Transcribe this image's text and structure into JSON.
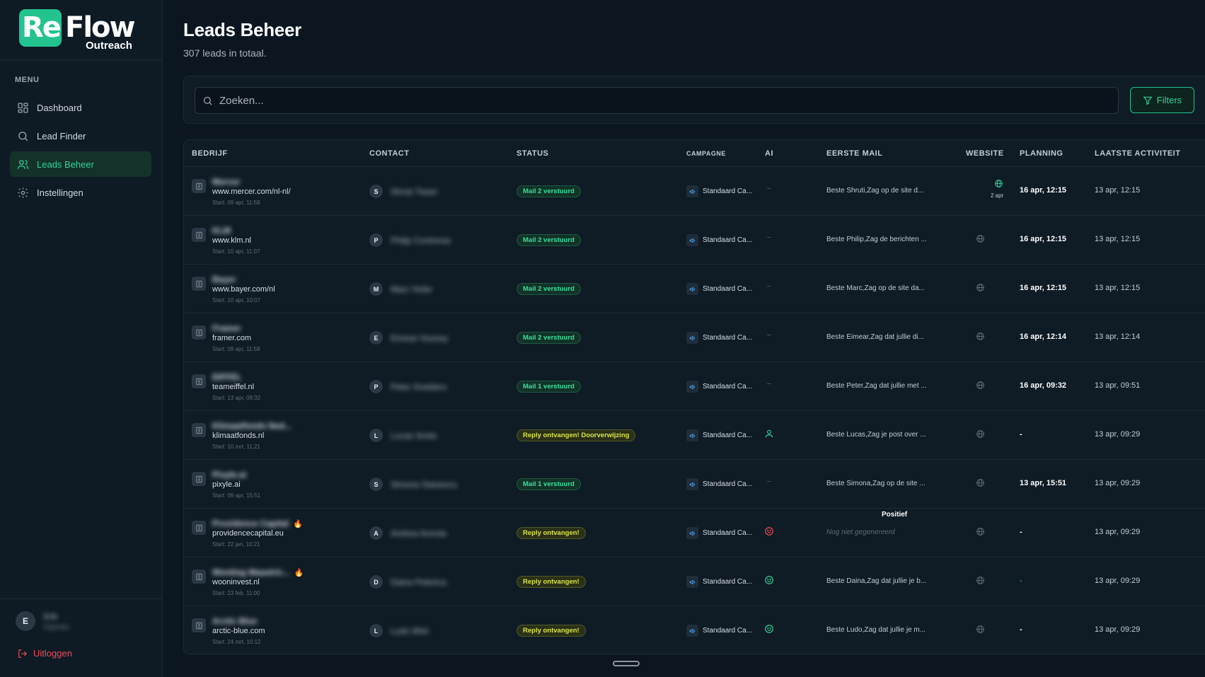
{
  "brand": {
    "logo_re": "Re",
    "logo_flow": "Flow",
    "logo_sub": "Outreach",
    "accent": "#22c38e"
  },
  "sidebar": {
    "menu_title": "MENU",
    "items": [
      {
        "label": "Dashboard",
        "icon": "dashboard-icon",
        "active": false
      },
      {
        "label": "Lead Finder",
        "icon": "search-icon",
        "active": false
      },
      {
        "label": "Leads Beheer",
        "icon": "users-icon",
        "active": true
      },
      {
        "label": "Instellingen",
        "icon": "gear-icon",
        "active": false
      }
    ],
    "user_initial": "E",
    "user_name": "Erik",
    "user_role": "Eigenaar",
    "logout_label": "Uitloggen"
  },
  "header": {
    "title": "Leads Beheer",
    "subtitle": "307 leads in totaal."
  },
  "search": {
    "placeholder": "Zoeken...",
    "value": ""
  },
  "filters_label": "Filters",
  "table": {
    "headers": {
      "bedrijf": "BEDRIJF",
      "contact": "CONTACT",
      "status": "STATUS",
      "campagne": "CAMPAGNE",
      "ai": "AI",
      "eerste_mail": "EERSTE MAIL",
      "website": "WEBSITE",
      "planning": "PLANNING",
      "laatste": "LAATSTE ACTIVITEIT"
    },
    "rows": [
      {
        "company": "Mercer",
        "site": "www.mercer.com/nl-nl/",
        "start": "Start: 09 apr, 11:58",
        "hot": false,
        "initial": "S",
        "contact": "Shruti Tiwari",
        "status": "Mail 2 verstuurd",
        "status_type": "green",
        "campaign": "Standaard Ca...",
        "ai": "–",
        "ai_type": "none",
        "mail": "Beste Shruti,Zag op de site d...",
        "mail_muted": false,
        "website_ok": true,
        "website_date": "2 apr",
        "planning": "16 apr, 12:15",
        "planning_muted": false,
        "last": "13 apr, 12:15"
      },
      {
        "company": "KLM",
        "site": "www.klm.nl",
        "start": "Start: 10 apr, 11:07",
        "hot": false,
        "initial": "P",
        "contact": "Philip Contreras",
        "status": "Mail 2 verstuurd",
        "status_type": "green",
        "campaign": "Standaard Ca...",
        "ai": "–",
        "ai_type": "none",
        "mail": "Beste Philip,Zag de berichten ...",
        "mail_muted": false,
        "website_ok": false,
        "website_date": "",
        "planning": "16 apr, 12:15",
        "planning_muted": false,
        "last": "13 apr, 12:15"
      },
      {
        "company": "Bayer",
        "site": "www.bayer.com/nl",
        "start": "Start: 10 apr, 10:07",
        "hot": false,
        "initial": "M",
        "contact": "Marc Hofer",
        "status": "Mail 2 verstuurd",
        "status_type": "green",
        "campaign": "Standaard Ca...",
        "ai": "–",
        "ai_type": "none",
        "mail": "Beste Marc,Zag op de site da...",
        "mail_muted": false,
        "website_ok": false,
        "website_date": "",
        "planning": "16 apr, 12:15",
        "planning_muted": false,
        "last": "13 apr, 12:15"
      },
      {
        "company": "Framer",
        "site": "framer.com",
        "start": "Start: 09 apr, 11:58",
        "hot": false,
        "initial": "E",
        "contact": "Eimear Hussey",
        "status": "Mail 2 verstuurd",
        "status_type": "green",
        "campaign": "Standaard Ca...",
        "ai": "–",
        "ai_type": "none",
        "mail": "Beste Eimear,Zag dat jullie di...",
        "mail_muted": false,
        "website_ok": false,
        "website_date": "",
        "planning": "16 apr, 12:14",
        "planning_muted": false,
        "last": "13 apr, 12:14"
      },
      {
        "company": "EIFFEL",
        "site": "teameiffel.nl",
        "start": "Start: 13 apr, 09:32",
        "hot": false,
        "initial": "P",
        "contact": "Peter Snelders",
        "status": "Mail 1 verstuurd",
        "status_type": "green",
        "campaign": "Standaard Ca...",
        "ai": "–",
        "ai_type": "none",
        "mail": "Beste Peter,Zag dat jullie met ...",
        "mail_muted": false,
        "website_ok": false,
        "website_date": "",
        "planning": "16 apr, 09:32",
        "planning_muted": false,
        "last": "13 apr, 09:51"
      },
      {
        "company": "Klimaatfonds Ned...",
        "site": "klimaatfonds.nl",
        "start": "Start: 10 mrt, 11:21",
        "hot": false,
        "initial": "L",
        "contact": "Lucas Smits",
        "status": "Reply ontvangen! Doorverwijzing",
        "status_type": "yellow",
        "campaign": "Standaard Ca...",
        "ai": "",
        "ai_type": "person",
        "mail": "Beste Lucas,Zag je post over ...",
        "mail_muted": false,
        "website_ok": false,
        "website_date": "",
        "planning": "-",
        "planning_muted": false,
        "last": "13 apr, 09:29"
      },
      {
        "company": "Pixyle.ai",
        "site": "pixyle.ai",
        "start": "Start: 09 apr, 15:51",
        "hot": false,
        "initial": "S",
        "contact": "Simona Stanescu",
        "status": "Mail 1 verstuurd",
        "status_type": "green",
        "campaign": "Standaard Ca...",
        "ai": "–",
        "ai_type": "none",
        "mail": "Beste Simona,Zag op de site ...",
        "mail_muted": false,
        "website_ok": false,
        "website_date": "",
        "planning": "13 apr, 15:51",
        "planning_muted": false,
        "last": "13 apr, 09:29"
      },
      {
        "company": "Providence Capital",
        "site": "providencecapital.eu",
        "start": "Start: 22 jan, 10:21",
        "hot": true,
        "initial": "A",
        "contact": "Andrea Arends",
        "status": "Reply ontvangen!",
        "status_type": "yellow",
        "campaign": "Standaard Ca...",
        "ai": "",
        "ai_type": "negative",
        "mail": "Nog niet gegenereerd",
        "mail_muted": true,
        "website_ok": false,
        "website_date": "",
        "planning": "-",
        "planning_muted": false,
        "last": "13 apr, 09:29"
      },
      {
        "company": "Wonting Maastric...",
        "site": "wooninvest.nl",
        "start": "Start: 23 feb, 11:00",
        "hot": true,
        "initial": "D",
        "contact": "Daina Peterica",
        "status": "Reply ontvangen!",
        "status_type": "yellow",
        "campaign": "Standaard Ca...",
        "ai": "",
        "ai_type": "positive",
        "mail": "Beste Daina,Zag dat jullie je b...",
        "mail_muted": false,
        "website_ok": false,
        "website_date": "",
        "planning": "-",
        "planning_muted": true,
        "last": "13 apr, 09:29"
      },
      {
        "company": "Arctic Blue",
        "site": "arctic-blue.com",
        "start": "Start: 24 mrt, 10:12",
        "hot": false,
        "initial": "L",
        "contact": "Ludo Wiel",
        "status": "Reply ontvangen!",
        "status_type": "yellow",
        "campaign": "Standaard Ca...",
        "ai": "",
        "ai_type": "positive",
        "mail": "Beste Ludo,Zag dat jullie je m...",
        "mail_muted": false,
        "website_ok": false,
        "website_date": "",
        "planning": "-",
        "planning_muted": false,
        "last": "13 apr, 09:29"
      }
    ]
  },
  "tooltip": "Positief"
}
